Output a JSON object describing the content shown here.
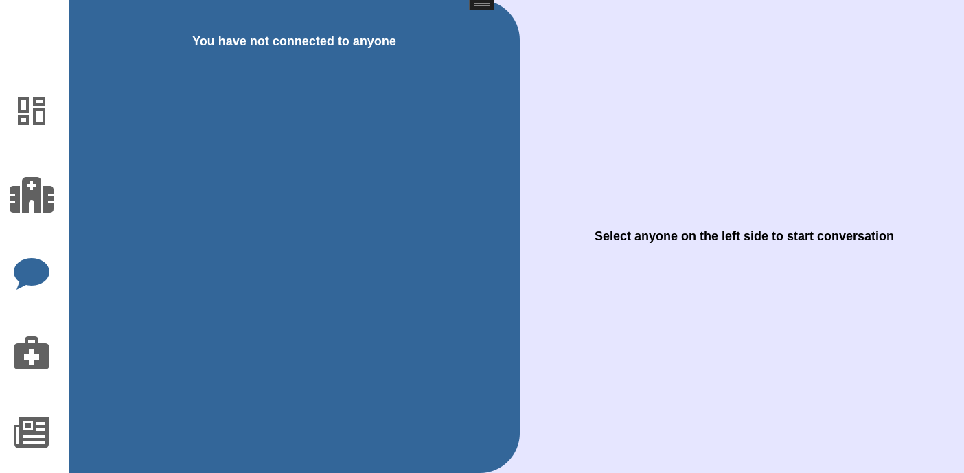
{
  "sidebar": {
    "items": [
      {
        "icon": "dashboard-icon",
        "active": false
      },
      {
        "icon": "hospital-icon",
        "active": false
      },
      {
        "icon": "chat-bubble-icon",
        "active": true
      },
      {
        "icon": "medical-kit-icon",
        "active": false
      },
      {
        "icon": "newspaper-icon",
        "active": false
      }
    ]
  },
  "contacts": {
    "empty_text": "You have not connected to anyone"
  },
  "conversation": {
    "placeholder_text": "Select anyone on the left side to start conversation"
  },
  "colors": {
    "panel": "#336699",
    "background": "#e6e6ff",
    "icon_default": "#616161",
    "icon_active": "#336699"
  }
}
